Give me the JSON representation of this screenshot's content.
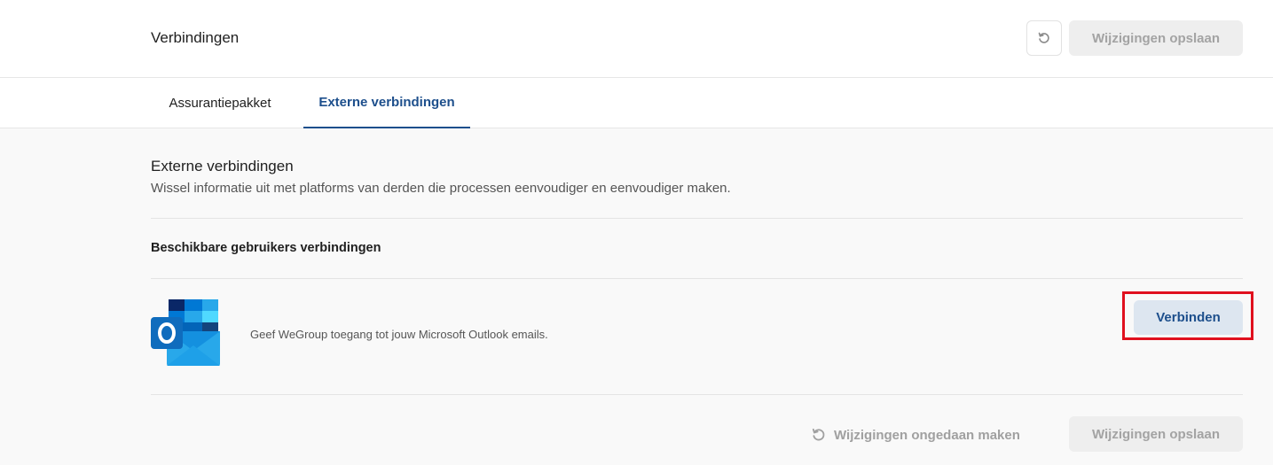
{
  "header": {
    "title": "Verbindingen",
    "undo_icon": "undo-icon",
    "save_label": "Wijzigingen opslaan"
  },
  "tabs": [
    {
      "label": "Assurantiepakket",
      "active": false
    },
    {
      "label": "Externe verbindingen",
      "active": true
    }
  ],
  "section": {
    "title": "Externe verbindingen",
    "subtitle": "Wissel informatie uit met platforms van derden die processen eenvoudiger en eenvoudiger maken."
  },
  "available": {
    "heading": "Beschikbare gebruikers verbindingen",
    "items": [
      {
        "logo": "outlook-logo",
        "description": "Geef WeGroup toegang tot jouw Microsoft Outlook emails.",
        "button_label": "Verbinden"
      }
    ]
  },
  "footer": {
    "undo_label": "Wijzigingen ongedaan maken",
    "save_label": "Wijzigingen opslaan"
  },
  "colors": {
    "accent": "#1d4f8c",
    "highlight": "#e0101e",
    "disabled_bg": "#eeeeee",
    "disabled_text": "#a3a3a3"
  }
}
